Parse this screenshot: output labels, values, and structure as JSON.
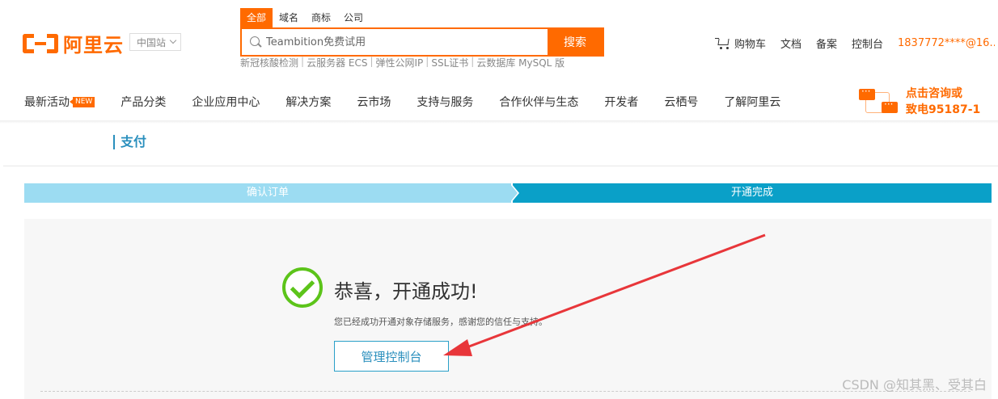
{
  "brand": {
    "logo_text": "阿里云",
    "accent": "#ff6a00"
  },
  "header": {
    "region": "中国站",
    "search_tabs": [
      "全部",
      "域名",
      "商标",
      "公司"
    ],
    "search_placeholder": "Teambition免费试用",
    "search_button": "搜索",
    "hotwords": [
      "新冠核酸检测",
      "云服务器 ECS",
      "弹性公网IP",
      "SSL证书",
      "云数据库 MySQL 版"
    ],
    "cart": "购物车",
    "docs": "文档",
    "filing": "备案",
    "console": "控制台",
    "account": "1837772****@16..."
  },
  "nav": {
    "items": [
      "最新活动",
      "产品分类",
      "企业应用中心",
      "解决方案",
      "云市场",
      "支持与服务",
      "合作伙伴与生态",
      "开发者",
      "云栖号",
      "了解阿里云"
    ],
    "new_badge": "NEW",
    "consult_line1": "点击咨询或",
    "consult_line2": "致电95187-1"
  },
  "payment": {
    "title": "支付",
    "steps": [
      "确认订单",
      "开通完成"
    ],
    "step_colors": {
      "done": "#9cdcf2",
      "current": "#0aa0c8"
    }
  },
  "result": {
    "title": "恭喜，开通成功!",
    "description": "您已经成功开通对象存储服务，感谢您的信任与支持。",
    "button": "管理控制台",
    "success_color": "#5cc41a"
  },
  "watermark": "CSDN @知其黑、受其白",
  "annotation": {
    "arrow_color": "#e8363a"
  }
}
